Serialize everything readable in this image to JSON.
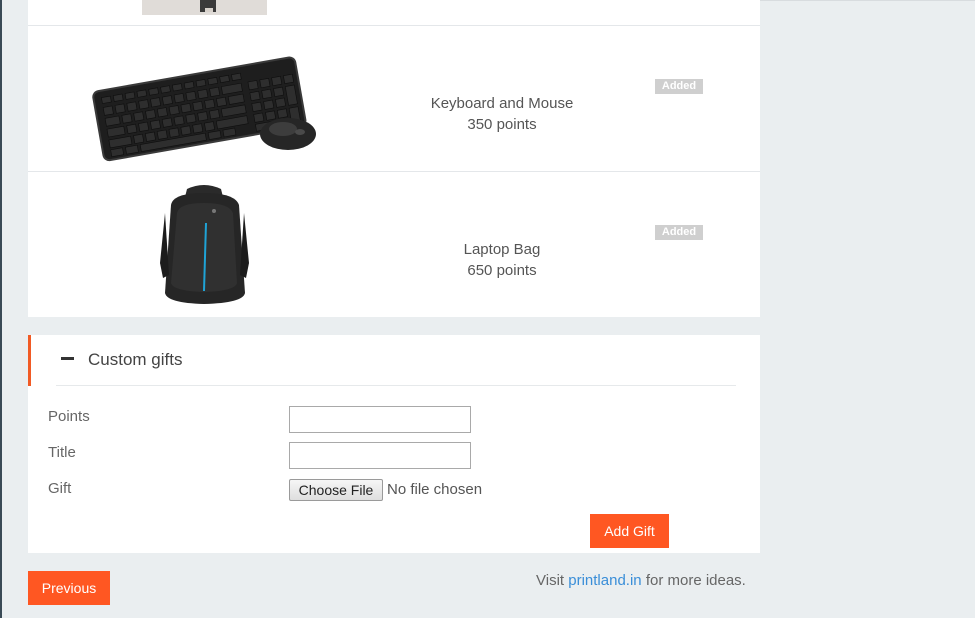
{
  "products": [
    {
      "name": "Keyboard and Mouse",
      "points": "350 points",
      "badge": "Added"
    },
    {
      "name": "Laptop Bag",
      "points": "650 points",
      "badge": "Added"
    }
  ],
  "custom_gifts": {
    "title": "Custom gifts",
    "fields": {
      "points_label": "Points",
      "points_value": "",
      "title_label": "Title",
      "title_value": "",
      "gift_label": "Gift",
      "file_button": "Choose File",
      "file_status": "No file chosen"
    },
    "add_button": "Add Gift"
  },
  "footer": {
    "previous_button": "Previous",
    "visit_prefix": "Visit",
    "link_text": "printland.in",
    "visit_suffix": "for more ideas."
  },
  "colors": {
    "accent": "#ff5722",
    "link": "#3a8ed8",
    "badge_bg": "#cfcfcf"
  },
  "icons": [
    "minus-icon"
  ]
}
